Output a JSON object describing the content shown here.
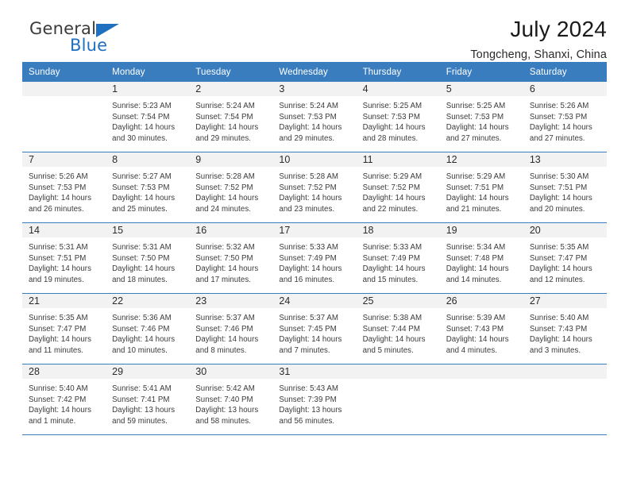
{
  "brand": {
    "name_top": "General",
    "name_bottom": "Blue",
    "triangle_icon": "triangle-icon",
    "color_dark": "#3b3b3b",
    "color_blue": "#1f70c1"
  },
  "header": {
    "title": "July 2024",
    "subtitle": "Tongcheng, Shanxi, China"
  },
  "theme": {
    "header_bg": "#3a7dbf",
    "header_text": "#ffffff",
    "daynum_bg": "#f2f2f2",
    "row_divider": "#3a7dbf",
    "body_text": "#3a3a3a"
  },
  "weekdays": [
    "Sunday",
    "Monday",
    "Tuesday",
    "Wednesday",
    "Thursday",
    "Friday",
    "Saturday"
  ],
  "weeks": [
    [
      {
        "day": "",
        "lines": []
      },
      {
        "day": "1",
        "lines": [
          "Sunrise: 5:23 AM",
          "Sunset: 7:54 PM",
          "Daylight: 14 hours",
          "and 30 minutes."
        ]
      },
      {
        "day": "2",
        "lines": [
          "Sunrise: 5:24 AM",
          "Sunset: 7:54 PM",
          "Daylight: 14 hours",
          "and 29 minutes."
        ]
      },
      {
        "day": "3",
        "lines": [
          "Sunrise: 5:24 AM",
          "Sunset: 7:53 PM",
          "Daylight: 14 hours",
          "and 29 minutes."
        ]
      },
      {
        "day": "4",
        "lines": [
          "Sunrise: 5:25 AM",
          "Sunset: 7:53 PM",
          "Daylight: 14 hours",
          "and 28 minutes."
        ]
      },
      {
        "day": "5",
        "lines": [
          "Sunrise: 5:25 AM",
          "Sunset: 7:53 PM",
          "Daylight: 14 hours",
          "and 27 minutes."
        ]
      },
      {
        "day": "6",
        "lines": [
          "Sunrise: 5:26 AM",
          "Sunset: 7:53 PM",
          "Daylight: 14 hours",
          "and 27 minutes."
        ]
      }
    ],
    [
      {
        "day": "7",
        "lines": [
          "Sunrise: 5:26 AM",
          "Sunset: 7:53 PM",
          "Daylight: 14 hours",
          "and 26 minutes."
        ]
      },
      {
        "day": "8",
        "lines": [
          "Sunrise: 5:27 AM",
          "Sunset: 7:53 PM",
          "Daylight: 14 hours",
          "and 25 minutes."
        ]
      },
      {
        "day": "9",
        "lines": [
          "Sunrise: 5:28 AM",
          "Sunset: 7:52 PM",
          "Daylight: 14 hours",
          "and 24 minutes."
        ]
      },
      {
        "day": "10",
        "lines": [
          "Sunrise: 5:28 AM",
          "Sunset: 7:52 PM",
          "Daylight: 14 hours",
          "and 23 minutes."
        ]
      },
      {
        "day": "11",
        "lines": [
          "Sunrise: 5:29 AM",
          "Sunset: 7:52 PM",
          "Daylight: 14 hours",
          "and 22 minutes."
        ]
      },
      {
        "day": "12",
        "lines": [
          "Sunrise: 5:29 AM",
          "Sunset: 7:51 PM",
          "Daylight: 14 hours",
          "and 21 minutes."
        ]
      },
      {
        "day": "13",
        "lines": [
          "Sunrise: 5:30 AM",
          "Sunset: 7:51 PM",
          "Daylight: 14 hours",
          "and 20 minutes."
        ]
      }
    ],
    [
      {
        "day": "14",
        "lines": [
          "Sunrise: 5:31 AM",
          "Sunset: 7:51 PM",
          "Daylight: 14 hours",
          "and 19 minutes."
        ]
      },
      {
        "day": "15",
        "lines": [
          "Sunrise: 5:31 AM",
          "Sunset: 7:50 PM",
          "Daylight: 14 hours",
          "and 18 minutes."
        ]
      },
      {
        "day": "16",
        "lines": [
          "Sunrise: 5:32 AM",
          "Sunset: 7:50 PM",
          "Daylight: 14 hours",
          "and 17 minutes."
        ]
      },
      {
        "day": "17",
        "lines": [
          "Sunrise: 5:33 AM",
          "Sunset: 7:49 PM",
          "Daylight: 14 hours",
          "and 16 minutes."
        ]
      },
      {
        "day": "18",
        "lines": [
          "Sunrise: 5:33 AM",
          "Sunset: 7:49 PM",
          "Daylight: 14 hours",
          "and 15 minutes."
        ]
      },
      {
        "day": "19",
        "lines": [
          "Sunrise: 5:34 AM",
          "Sunset: 7:48 PM",
          "Daylight: 14 hours",
          "and 14 minutes."
        ]
      },
      {
        "day": "20",
        "lines": [
          "Sunrise: 5:35 AM",
          "Sunset: 7:47 PM",
          "Daylight: 14 hours",
          "and 12 minutes."
        ]
      }
    ],
    [
      {
        "day": "21",
        "lines": [
          "Sunrise: 5:35 AM",
          "Sunset: 7:47 PM",
          "Daylight: 14 hours",
          "and 11 minutes."
        ]
      },
      {
        "day": "22",
        "lines": [
          "Sunrise: 5:36 AM",
          "Sunset: 7:46 PM",
          "Daylight: 14 hours",
          "and 10 minutes."
        ]
      },
      {
        "day": "23",
        "lines": [
          "Sunrise: 5:37 AM",
          "Sunset: 7:46 PM",
          "Daylight: 14 hours",
          "and 8 minutes."
        ]
      },
      {
        "day": "24",
        "lines": [
          "Sunrise: 5:37 AM",
          "Sunset: 7:45 PM",
          "Daylight: 14 hours",
          "and 7 minutes."
        ]
      },
      {
        "day": "25",
        "lines": [
          "Sunrise: 5:38 AM",
          "Sunset: 7:44 PM",
          "Daylight: 14 hours",
          "and 5 minutes."
        ]
      },
      {
        "day": "26",
        "lines": [
          "Sunrise: 5:39 AM",
          "Sunset: 7:43 PM",
          "Daylight: 14 hours",
          "and 4 minutes."
        ]
      },
      {
        "day": "27",
        "lines": [
          "Sunrise: 5:40 AM",
          "Sunset: 7:43 PM",
          "Daylight: 14 hours",
          "and 3 minutes."
        ]
      }
    ],
    [
      {
        "day": "28",
        "lines": [
          "Sunrise: 5:40 AM",
          "Sunset: 7:42 PM",
          "Daylight: 14 hours",
          "and 1 minute."
        ]
      },
      {
        "day": "29",
        "lines": [
          "Sunrise: 5:41 AM",
          "Sunset: 7:41 PM",
          "Daylight: 13 hours",
          "and 59 minutes."
        ]
      },
      {
        "day": "30",
        "lines": [
          "Sunrise: 5:42 AM",
          "Sunset: 7:40 PM",
          "Daylight: 13 hours",
          "and 58 minutes."
        ]
      },
      {
        "day": "31",
        "lines": [
          "Sunrise: 5:43 AM",
          "Sunset: 7:39 PM",
          "Daylight: 13 hours",
          "and 56 minutes."
        ]
      },
      {
        "day": "",
        "lines": []
      },
      {
        "day": "",
        "lines": []
      },
      {
        "day": "",
        "lines": []
      }
    ]
  ]
}
